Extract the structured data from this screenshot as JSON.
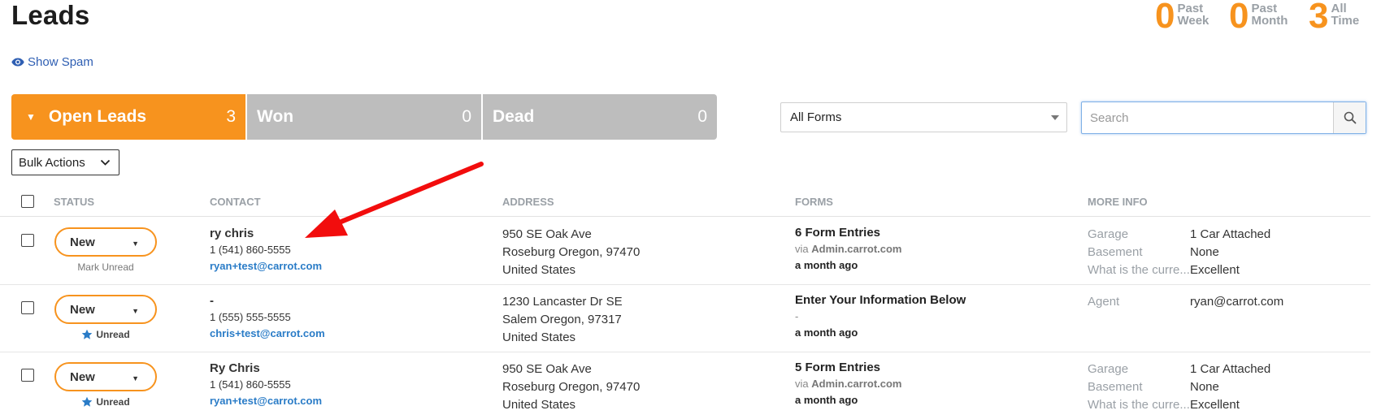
{
  "page": {
    "title": "Leads"
  },
  "stats": [
    {
      "count": "0",
      "label1": "Past",
      "label2": "Week"
    },
    {
      "count": "0",
      "label1": "Past",
      "label2": "Month"
    },
    {
      "count": "3",
      "label1": "All",
      "label2": "Time"
    }
  ],
  "show_spam": "Show Spam",
  "tabs": [
    {
      "label": "Open Leads",
      "count": "3"
    },
    {
      "label": "Won",
      "count": "0"
    },
    {
      "label": "Dead",
      "count": "0"
    }
  ],
  "filters": {
    "forms_selected": "All Forms",
    "search_placeholder": "Search"
  },
  "bulk_actions": "Bulk Actions",
  "columns": {
    "status": "STATUS",
    "contact": "CONTACT",
    "address": "ADDRESS",
    "forms": "FORMS",
    "more_info": "MORE INFO"
  },
  "colors": {
    "accent": "#f7931e",
    "tab_inactive": "#bdbdbd",
    "link": "#2a7cc7"
  },
  "rows": [
    {
      "status": "New",
      "read_action": "Mark Unread",
      "name": "ry chris",
      "phone": "1 (541) 860-5555",
      "email": "ryan+test@carrot.com",
      "address": [
        "950 SE Oak Ave",
        "Roseburg Oregon, 97470",
        "United States"
      ],
      "form_title": "6 Form Entries",
      "via_prefix": "via",
      "via_site": "Admin.carrot.com",
      "time": "a month ago",
      "info": [
        {
          "key": "Garage",
          "value": "1 Car Attached"
        },
        {
          "key": "Basement",
          "value": "None"
        },
        {
          "key": "What is the curre...",
          "value": "Excellent"
        }
      ]
    },
    {
      "status": "New",
      "read_action": "Unread",
      "name": "-",
      "phone": "1 (555) 555-5555",
      "email": "chris+test@carrot.com",
      "address": [
        "1230 Lancaster Dr SE",
        "Salem Oregon, 97317",
        "United States"
      ],
      "form_title": "Enter Your Information Below",
      "via_prefix": "-",
      "via_site": "",
      "time": "a month ago",
      "info": [
        {
          "key": "Agent",
          "value": "ryan@carrot.com"
        }
      ]
    },
    {
      "status": "New",
      "read_action": "Unread",
      "name": "Ry Chris",
      "phone": "1 (541) 860-5555",
      "email": "ryan+test@carrot.com",
      "address": [
        "950 SE Oak Ave",
        "Roseburg Oregon, 97470",
        "United States"
      ],
      "form_title": "5 Form Entries",
      "via_prefix": "via",
      "via_site": "Admin.carrot.com",
      "time": "a month ago",
      "info": [
        {
          "key": "Garage",
          "value": "1 Car Attached"
        },
        {
          "key": "Basement",
          "value": "None"
        },
        {
          "key": "What is the curre...",
          "value": "Excellent"
        }
      ]
    }
  ]
}
